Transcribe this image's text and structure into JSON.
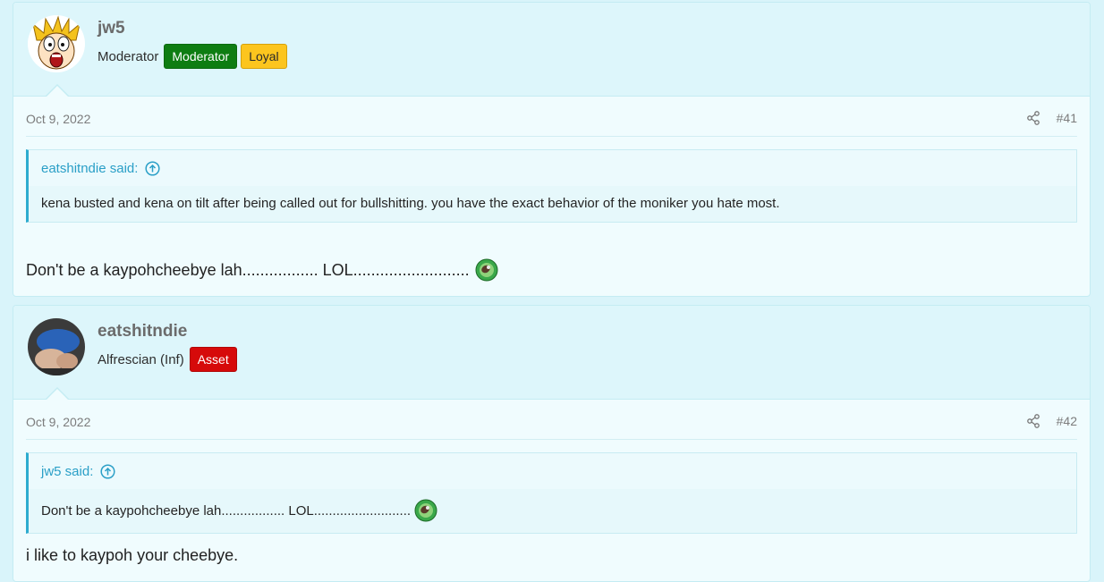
{
  "posts": [
    {
      "username": "jw5",
      "user_title": "Moderator",
      "badges": [
        "Moderator",
        "Loyal"
      ],
      "date": "Oct 9, 2022",
      "post_number": "#41",
      "quote": {
        "author": "eatshitndie said:",
        "text": "kena busted and kena on tilt after being called out for bullshitting. you have the exact behavior of the moniker you hate most."
      },
      "text": "Don't be a kaypohcheebye lah................. LOL.........................."
    },
    {
      "username": "eatshitndie",
      "user_title": "Alfrescian (Inf)",
      "badges": [
        "Asset"
      ],
      "date": "Oct 9, 2022",
      "post_number": "#42",
      "quote": {
        "author": "jw5 said:",
        "text": "Don't be a kaypohcheebye lah................. LOL.........................."
      },
      "text": "i like to kaypoh your cheebye."
    }
  ],
  "icons": {
    "share": "share-icon",
    "quote_jump": "arrow-up-circle-icon",
    "smiley": "green-smiley-icon"
  },
  "colors": {
    "background": "#d9f4fa",
    "post_bg": "#f0fcfe",
    "moderator_badge": "#0e7d12",
    "loyal_badge": "#fcc51e",
    "asset_badge": "#d60a0a",
    "link": "#2a9fc7"
  }
}
